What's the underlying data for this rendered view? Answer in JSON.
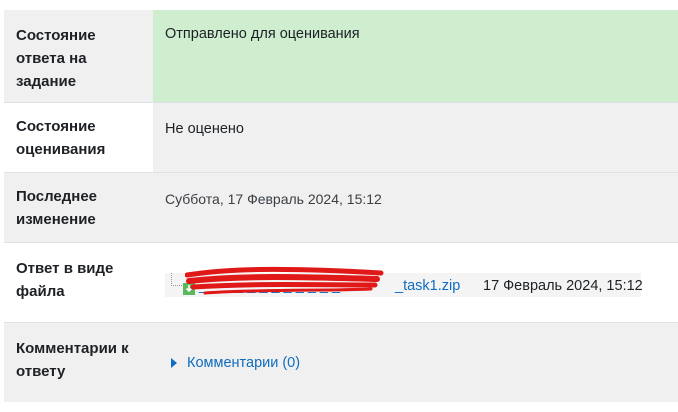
{
  "rows": {
    "submission_status": {
      "label": "Состояние ответа на задание",
      "value": "Отправлено для оценивания"
    },
    "grading_status": {
      "label": "Состояние оценивания",
      "value": "Не оценено"
    },
    "last_modified": {
      "label": "Последнее изменение",
      "value": "Суббота, 17 Февраль 2024, 15:12"
    },
    "file_submission": {
      "label": "Ответ в виде файла",
      "file_name_visible": "_task1.zip",
      "file_date": "17 Февраль 2024, 15:12"
    },
    "submission_comments": {
      "label": "Комментарии к ответу",
      "link": "Комментарии (0)"
    }
  },
  "colors": {
    "submitted_bg": "#cfeed0",
    "row_alt_bg": "#f0f0f0",
    "link": "#0f6cbf",
    "redaction": "#e01818"
  },
  "icons": {
    "file": "archive-download-icon",
    "comments_toggle": "caret-right-icon"
  }
}
